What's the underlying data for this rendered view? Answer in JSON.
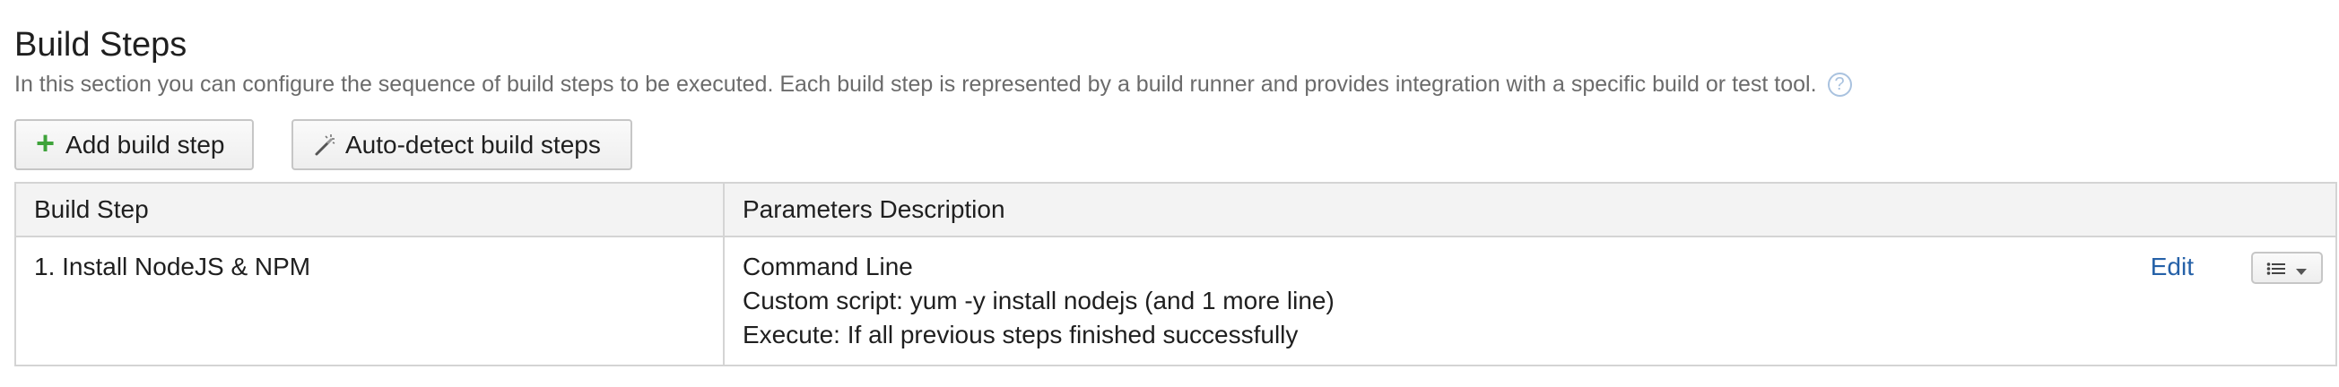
{
  "section": {
    "title": "Build Steps",
    "description": "In this section you can configure the sequence of build steps to be executed. Each build step is represented by a build runner and provides integration with a specific build or test tool.",
    "help_icon": "question-circle-icon"
  },
  "toolbar": {
    "add_label": "Add build step",
    "add_icon": "plus-icon",
    "autodetect_label": "Auto-detect build steps",
    "autodetect_icon": "magic-wand-icon"
  },
  "table": {
    "columns": [
      "Build Step",
      "Parameters Description"
    ],
    "rows": [
      {
        "step": "1. Install NodeJS & NPM",
        "params": [
          "Command Line",
          "Custom script: yum -y install nodejs (and 1 more line)",
          "Execute: If all previous steps finished successfully"
        ],
        "edit_label": "Edit",
        "menu_icon": "list-dropdown-icon"
      }
    ]
  },
  "colors": {
    "accent_link": "#2561a8",
    "plus_green": "#3fa33b",
    "muted_text": "#6b6b6b",
    "header_bg": "#f3f3f3"
  }
}
